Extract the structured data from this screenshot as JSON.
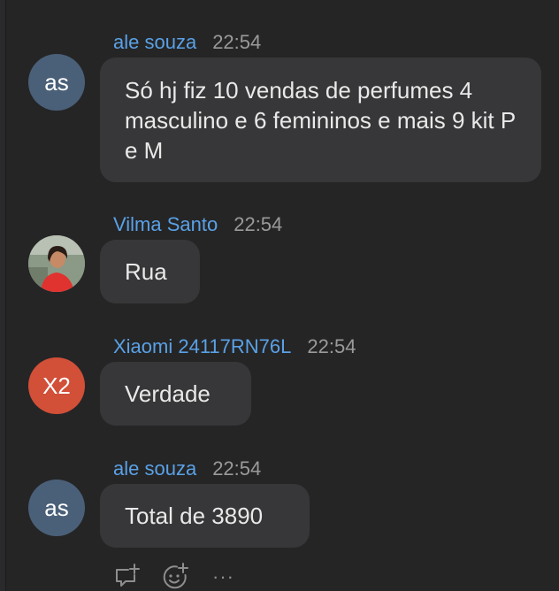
{
  "messages": [
    {
      "avatar_initials": "as",
      "sender": "ale souza",
      "time": "22:54",
      "text": "Só hj fiz 10 vendas de perfumes 4 masculino e 6 femininos e mais 9 kit P e M"
    },
    {
      "avatar_initials": "",
      "sender": "Vilma Santo",
      "time": "22:54",
      "text": "Rua"
    },
    {
      "avatar_initials": "X2",
      "sender": "Xiaomi 24117RN76L",
      "time": "22:54",
      "text": "Verdade"
    },
    {
      "avatar_initials": "as",
      "sender": "ale souza",
      "time": "22:54",
      "text": "Total de 3890"
    }
  ],
  "actions": {
    "more_glyph": "···"
  },
  "colors": {
    "background": "#252526",
    "bubble": "#373739",
    "sender": "#5aa1e6",
    "avatar_blue": "#4a6079",
    "avatar_red": "#d24f38"
  }
}
